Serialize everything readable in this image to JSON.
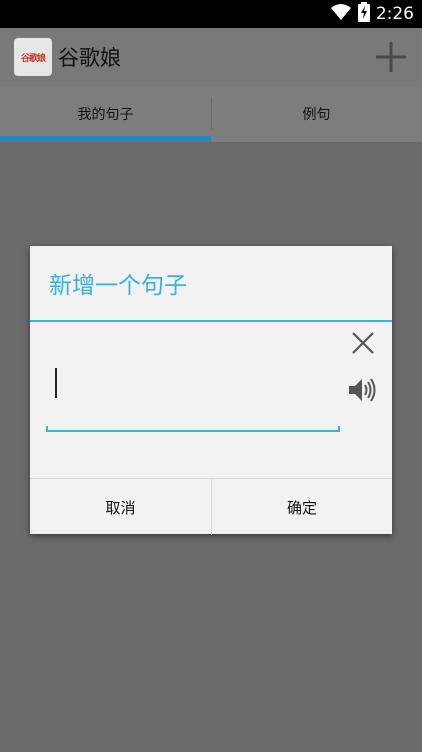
{
  "status_bar": {
    "time": "2:26",
    "icons": [
      "wifi-icon",
      "battery-charging-icon"
    ]
  },
  "app_bar": {
    "logo_text": "谷歌娘",
    "title": "谷歌娘",
    "action_icon": "plus-icon"
  },
  "tabs": [
    {
      "label": "我的句子",
      "selected": true
    },
    {
      "label": "例句",
      "selected": false
    }
  ],
  "dialog": {
    "title": "新增一个句子",
    "input_value": "",
    "icons": [
      "close-icon",
      "speaker-icon"
    ],
    "cancel_label": "取消",
    "ok_label": "确定"
  },
  "colors": {
    "accent": "#36b3e0",
    "tab_indicator": "#2a8ab0",
    "scrim": "#6b6b6b"
  }
}
